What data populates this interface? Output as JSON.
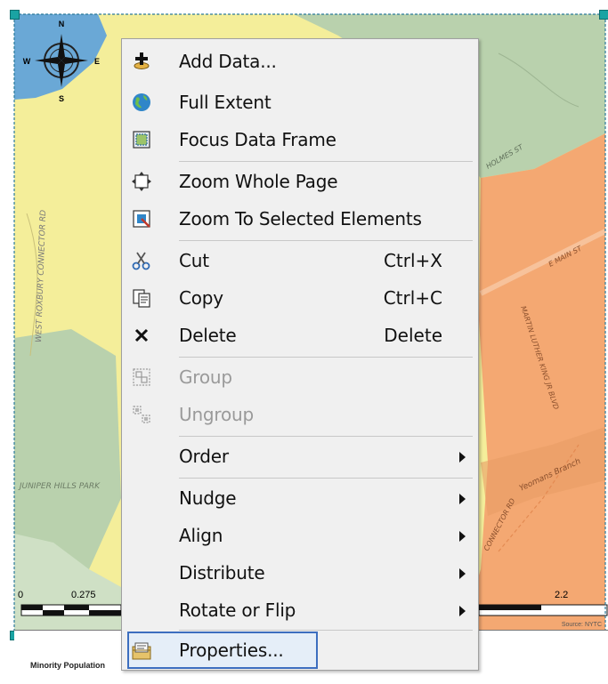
{
  "map": {
    "north_label": "N",
    "south_label": "S",
    "east_label": "E",
    "west_label": "W",
    "scale_start": "0",
    "scale_mid": "0.275",
    "scale_end": "2.2",
    "source_label": "Source: NYTC",
    "place_labels": [
      "WEST ROXBURY CONNECTOR RD",
      "JUNIPER HILLS PARK",
      "HOLMES ST",
      "E MAIN ST",
      "MARTIN LUTHER KING JR BLVD",
      "Yeomans Branch",
      "CONNECTOR RD"
    ],
    "legend_title": "Minority Population"
  },
  "context_menu": {
    "items": [
      {
        "label": "Add Data...",
        "icon": "add-data-icon",
        "enabled": true
      },
      {
        "label": "Full Extent",
        "icon": "globe-icon",
        "enabled": true
      },
      {
        "label": "Focus Data Frame",
        "icon": "focus-frame-icon",
        "enabled": true
      },
      {
        "label": "Zoom Whole Page",
        "icon": "zoom-page-icon",
        "enabled": true
      },
      {
        "label": "Zoom To Selected Elements",
        "icon": "zoom-selected-icon",
        "enabled": true
      },
      {
        "label": "Cut",
        "shortcut": "Ctrl+X",
        "icon": "scissors-icon",
        "enabled": true
      },
      {
        "label": "Copy",
        "shortcut": "Ctrl+C",
        "icon": "copy-icon",
        "enabled": true
      },
      {
        "label": "Delete",
        "shortcut": "Delete",
        "icon": "delete-x-icon",
        "enabled": true
      },
      {
        "label": "Group",
        "icon": "group-icon",
        "enabled": false
      },
      {
        "label": "Ungroup",
        "icon": "ungroup-icon",
        "enabled": false
      },
      {
        "label": "Order",
        "submenu": true,
        "enabled": true
      },
      {
        "label": "Nudge",
        "submenu": true,
        "enabled": true
      },
      {
        "label": "Align",
        "submenu": true,
        "enabled": true
      },
      {
        "label": "Distribute",
        "submenu": true,
        "enabled": true
      },
      {
        "label": "Rotate or Flip",
        "submenu": true,
        "enabled": true
      },
      {
        "label": "Properties...",
        "icon": "properties-icon",
        "enabled": true,
        "highlighted": true
      }
    ]
  },
  "colors": {
    "highlight_border": "#3d6ebf",
    "selection_handle": "#1aa3a3",
    "map_yellow": "#f4ee9a",
    "map_orange": "#f4a872",
    "map_green": "#b9d1ad",
    "map_blue": "#6aa8d6"
  }
}
